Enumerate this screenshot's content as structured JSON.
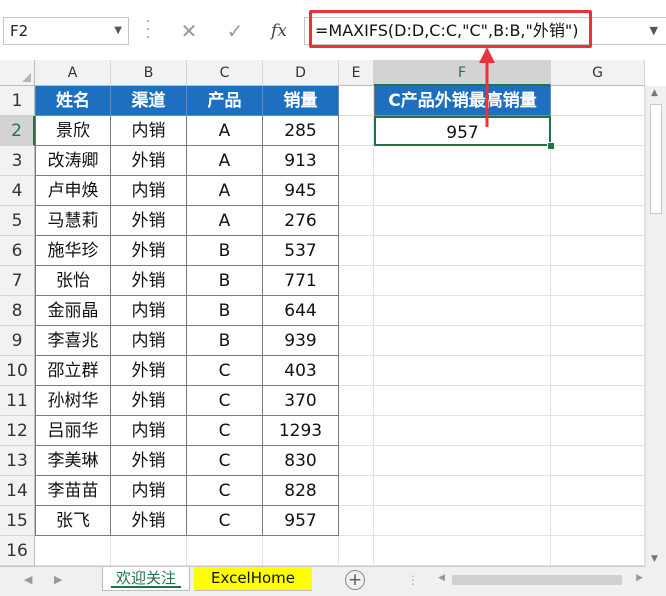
{
  "formula_bar": {
    "name_box": "F2",
    "cancel_icon": "✕",
    "enter_icon": "✓",
    "fx_label": "fx",
    "formula": "=MAXIFS(D:D,C:C,\"C\",B:B,\"外销\")"
  },
  "columns": [
    "A",
    "B",
    "C",
    "D",
    "E",
    "F",
    "G"
  ],
  "rows": [
    "1",
    "2",
    "3",
    "4",
    "5",
    "6",
    "7",
    "8",
    "9",
    "10",
    "11",
    "12",
    "13",
    "14",
    "15",
    "16"
  ],
  "selected": {
    "column": "F",
    "row": "2"
  },
  "table": {
    "headers": [
      "姓名",
      "渠道",
      "产品",
      "销量"
    ],
    "rows": [
      [
        "景欣",
        "内销",
        "A",
        "285"
      ],
      [
        "改涛卿",
        "外销",
        "A",
        "913"
      ],
      [
        "卢申焕",
        "内销",
        "A",
        "945"
      ],
      [
        "马慧莉",
        "外销",
        "A",
        "276"
      ],
      [
        "施华珍",
        "外销",
        "B",
        "537"
      ],
      [
        "张怡",
        "外销",
        "B",
        "771"
      ],
      [
        "金丽晶",
        "内销",
        "B",
        "644"
      ],
      [
        "李喜兆",
        "内销",
        "B",
        "939"
      ],
      [
        "邵立群",
        "外销",
        "C",
        "403"
      ],
      [
        "孙树华",
        "外销",
        "C",
        "370"
      ],
      [
        "吕丽华",
        "内销",
        "C",
        "1293"
      ],
      [
        "李美琳",
        "外销",
        "C",
        "830"
      ],
      [
        "李苗苗",
        "内销",
        "C",
        "828"
      ],
      [
        "张飞",
        "外销",
        "C",
        "957"
      ]
    ]
  },
  "result": {
    "header": "C产品外销最高销量",
    "value": "957"
  },
  "sheet_tabs": [
    "欢迎关注",
    "ExcelHome"
  ],
  "colors": {
    "header_fill": "#1f6fc0",
    "selection_green": "#217346",
    "annotation_red": "#e8323c",
    "tab_highlight": "#ffff00"
  },
  "icons": [
    "cancel-icon",
    "enter-icon",
    "function-icon",
    "add-sheet-icon"
  ]
}
